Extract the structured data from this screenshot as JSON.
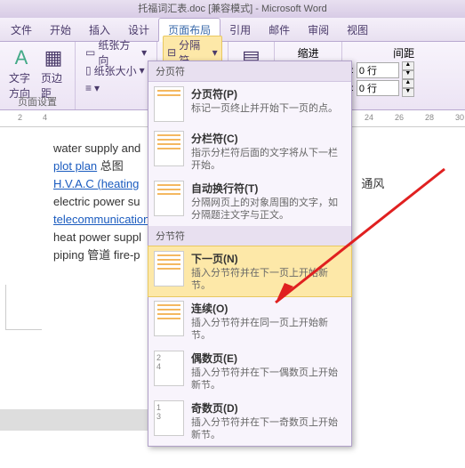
{
  "title": "托福词汇表.doc [兼容模式] - Microsoft Word",
  "tabs": {
    "file": "文件",
    "home": "开始",
    "insert": "插入",
    "design": "设计",
    "layout": "页面布局",
    "ref": "引用",
    "mail": "邮件",
    "review": "审阅",
    "view": "视图"
  },
  "ribbon": {
    "text_dir": "文字方向",
    "margin": "页边距",
    "orient": "纸张方向",
    "size": "纸张大小",
    "breaks": "分隔符",
    "indent": "缩进",
    "spacing": "间距",
    "page_setup": "页面设置",
    "rows": "0 行"
  },
  "menu": {
    "page_hdr": "分页符",
    "sect_hdr": "分节符",
    "page_break": {
      "t": "分页符(P)",
      "d": "标记一页终止并开始下一页的点。"
    },
    "col_break": {
      "t": "分栏符(C)",
      "d": "指示分栏符后面的文字将从下一栏开始。"
    },
    "wrap": {
      "t": "自动换行符(T)",
      "d": "分隔网页上的对象周围的文字，如分隔题注文字与正文。"
    },
    "next": {
      "t": "下一页(N)",
      "d": "插入分节符并在下一页上开始新节。"
    },
    "cont": {
      "t": "连续(O)",
      "d": "插入分节符并在同一页上开始新节。"
    },
    "even": {
      "t": "偶数页(E)",
      "d": "插入分节符并在下一偶数页上开始新节。"
    },
    "odd": {
      "t": "奇数页(D)",
      "d": "插入分节符并在下一奇数页上开始新节。"
    }
  },
  "doc": {
    "l1": "water supply and",
    "l2a": "plot plan",
    "l2b": "  总图",
    "l3a": "H.V.A.C (heating",
    "l3b": "通风",
    "l4": "electric power su",
    "l5": "telecommunication",
    "l6": "heat power suppl",
    "l7": "piping  管道 fire-p"
  },
  "ruler": {
    "n2": "2",
    "n4": "4",
    "n24": "24",
    "n26": "26",
    "n28": "28",
    "n30": "30"
  }
}
